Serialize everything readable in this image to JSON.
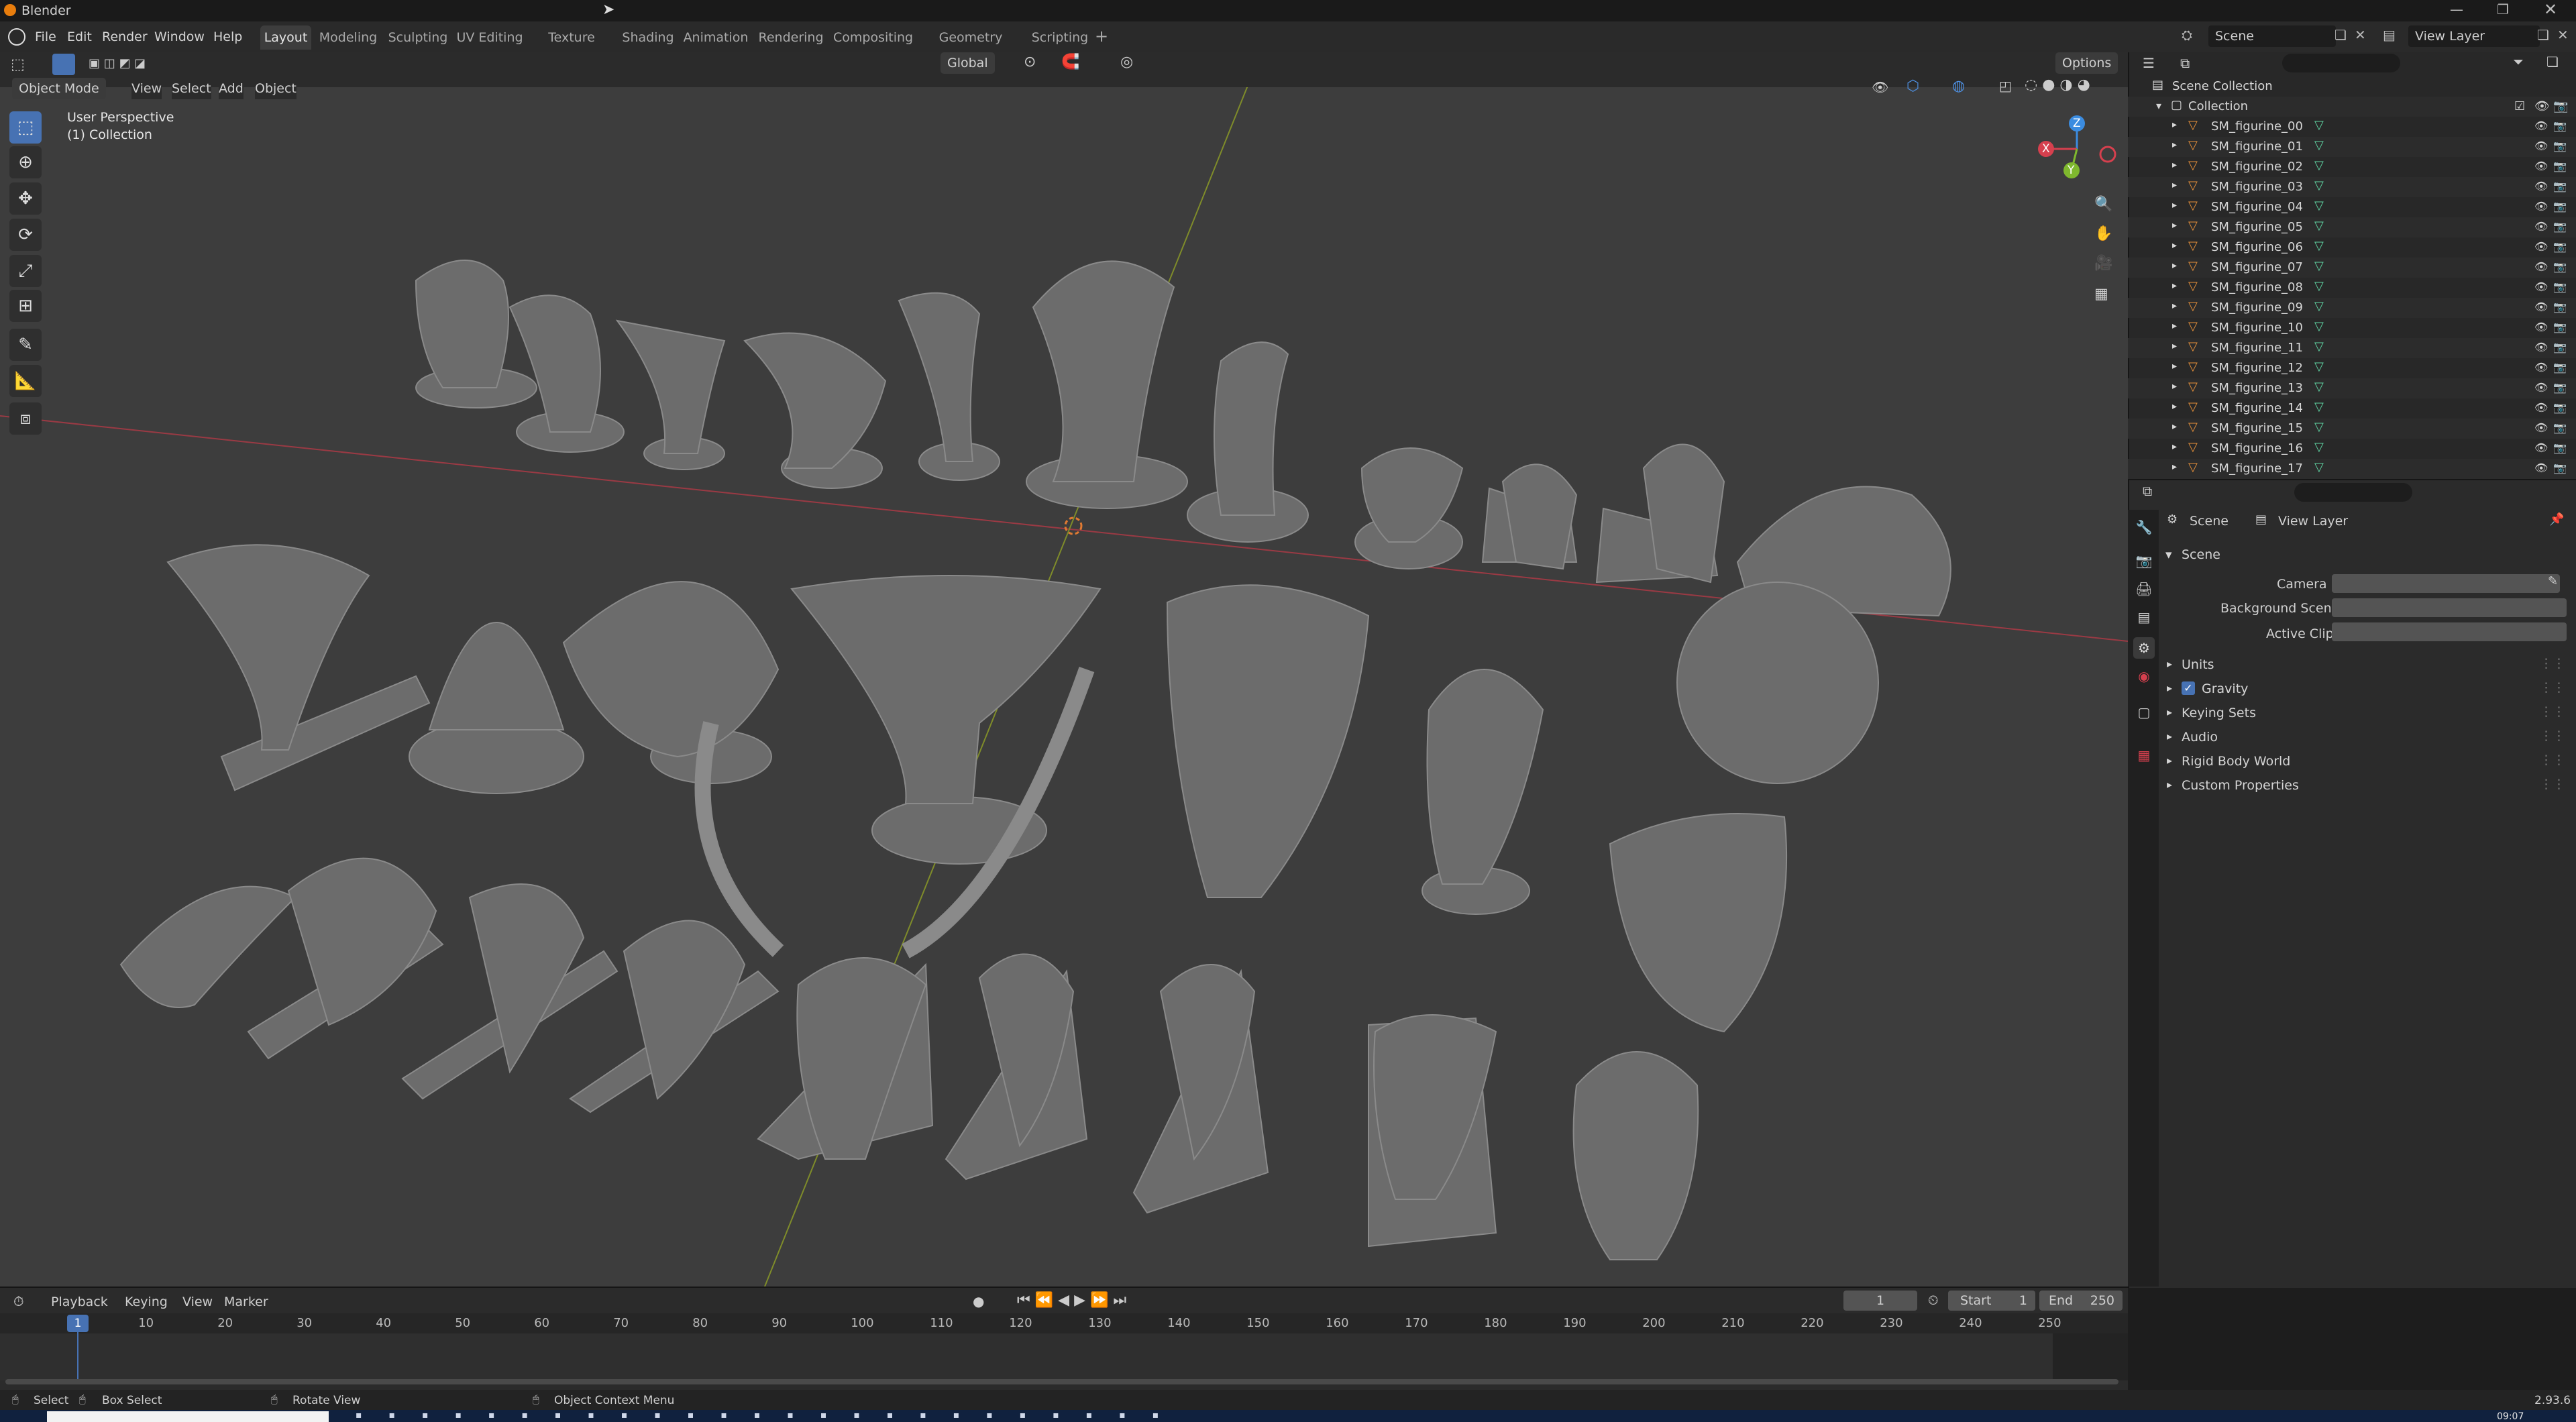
{
  "window": {
    "title": "Blender"
  },
  "menu": {
    "file": "File",
    "edit": "Edit",
    "render": "Render",
    "window": "Window",
    "help": "Help"
  },
  "workspaces": [
    "Layout",
    "Modeling",
    "Sculpting",
    "UV Editing",
    "Texture Paint",
    "Shading",
    "Animation",
    "Rendering",
    "Compositing",
    "Geometry Nodes",
    "Scripting"
  ],
  "topright": {
    "scene": "Scene",
    "view_layer": "View Layer"
  },
  "viewport_header": {
    "mode": "Object Mode",
    "view": "View",
    "select": "Select",
    "add": "Add",
    "object": "Object",
    "transform_orientation": "Global",
    "options": "Options"
  },
  "viewport": {
    "perspective_label": "User Perspective",
    "collection_label": "(1) Collection",
    "gizmo": {
      "x": "X",
      "y": "Y",
      "z": "Z"
    }
  },
  "outliner": {
    "scene_collection": "Scene Collection",
    "collection": "Collection",
    "objects": [
      "SM_figurine_00",
      "SM_figurine_01",
      "SM_figurine_02",
      "SM_figurine_03",
      "SM_figurine_04",
      "SM_figurine_05",
      "SM_figurine_06",
      "SM_figurine_07",
      "SM_figurine_08",
      "SM_figurine_09",
      "SM_figurine_10",
      "SM_figurine_11",
      "SM_figurine_12",
      "SM_figurine_13",
      "SM_figurine_14",
      "SM_figurine_15",
      "SM_figurine_16",
      "SM_figurine_17"
    ]
  },
  "properties": {
    "breadcrumb_scene": "Scene",
    "breadcrumb_view_layer": "View Layer",
    "panel_scene": "Scene",
    "camera_label": "Camera",
    "background_scene_label": "Background Scene",
    "active_clip_label": "Active Clip",
    "panels": [
      "Units",
      "Gravity",
      "Keying Sets",
      "Audio",
      "Rigid Body World",
      "Custom Properties"
    ],
    "gravity_checked": true
  },
  "timeline": {
    "playback": "Playback",
    "keying": "Keying",
    "view": "View",
    "marker": "Marker",
    "current_frame": "1",
    "start_label": "Start",
    "start_value": "1",
    "end_label": "End",
    "end_value": "250",
    "ruler": [
      "10",
      "20",
      "30",
      "40",
      "50",
      "60",
      "70",
      "80",
      "90",
      "100",
      "110",
      "120",
      "130",
      "140",
      "150",
      "160",
      "170",
      "180",
      "190",
      "200",
      "210",
      "220",
      "230",
      "240",
      "250"
    ],
    "playhead_label": "1"
  },
  "statusbar": {
    "select": "Select",
    "box_select": "Box Select",
    "rotate_view": "Rotate View",
    "context_menu": "Object Context Menu",
    "version": "2.93.6"
  },
  "taskbar": {
    "clock": "09:07"
  },
  "colors": {
    "accent": "#4772b3",
    "object_icon": "#e8913a",
    "mesh_icon": "#5fd6a4",
    "x_axis": "#d6404e",
    "y_axis": "#7fb82e",
    "z_axis": "#3b8ce0"
  }
}
